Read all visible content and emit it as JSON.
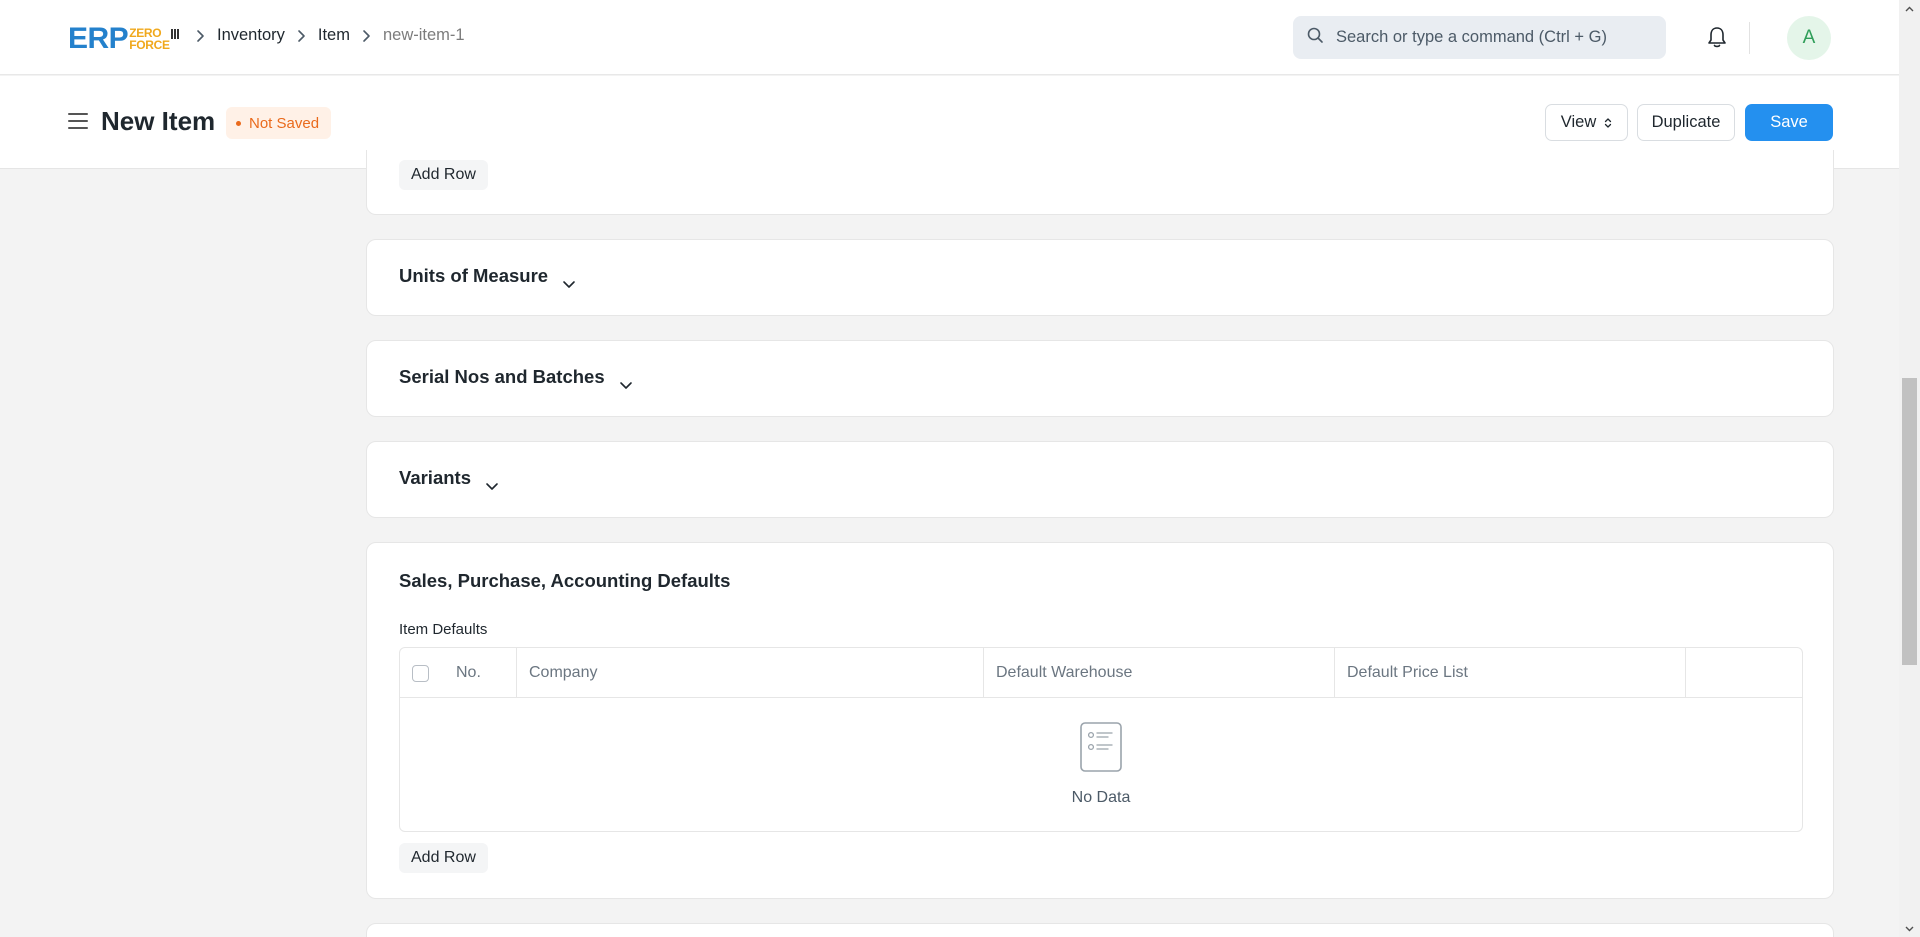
{
  "app": {
    "logo_main": "ERP",
    "logo_top": "ZERO",
    "logo_bottom": "FORCE"
  },
  "breadcrumbs": [
    {
      "label": "Inventory"
    },
    {
      "label": "Item"
    },
    {
      "label": "new-item-1"
    }
  ],
  "search": {
    "placeholder": "Search or type a command (Ctrl + G)"
  },
  "user": {
    "avatar_initial": "A"
  },
  "page": {
    "title": "New Item",
    "status": "Not Saved",
    "actions": {
      "view_label": "View",
      "duplicate_label": "Duplicate",
      "save_label": "Save"
    }
  },
  "sections": {
    "top": {
      "add_row_label": "Add Row"
    },
    "uom": {
      "title": "Units of Measure"
    },
    "serial": {
      "title": "Serial Nos and Batches"
    },
    "variants": {
      "title": "Variants"
    },
    "defaults": {
      "title": "Sales, Purchase, Accounting Defaults",
      "table_label": "Item Defaults",
      "columns": [
        "No.",
        "Company",
        "Default Warehouse",
        "Default Price List"
      ],
      "empty_text": "No Data",
      "add_row_label": "Add Row"
    }
  },
  "colors": {
    "primary": "#2490ef",
    "logo_blue": "#2481cc",
    "logo_orange": "#f0a81c",
    "status_orange": "#ea6a1c"
  }
}
